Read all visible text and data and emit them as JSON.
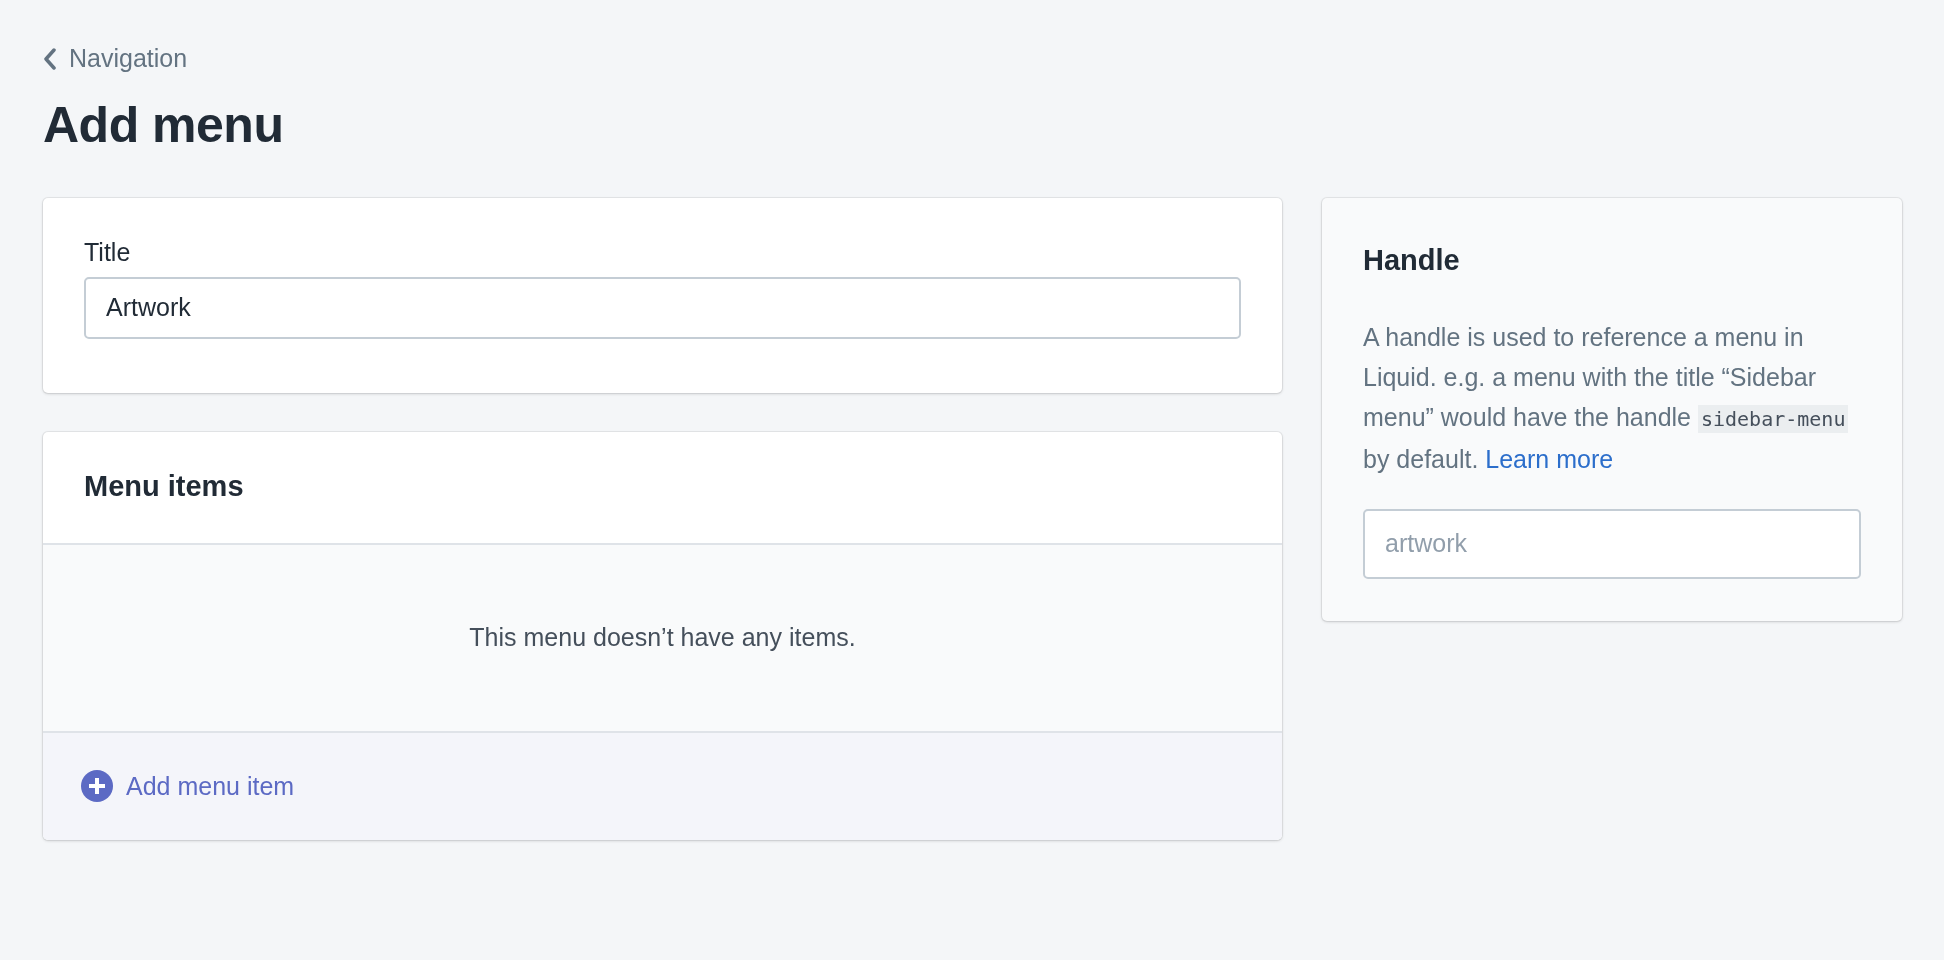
{
  "back_link": {
    "label": "Navigation"
  },
  "page_title": "Add menu",
  "title_card": {
    "label": "Title",
    "value": "Artwork"
  },
  "menu_items_card": {
    "title": "Menu items",
    "empty_message": "This menu doesn’t have any items.",
    "add_button": "Add menu item"
  },
  "handle_card": {
    "title": "Handle",
    "description": {
      "before": "A handle is used to reference a menu in Liquid. e.g. a menu with the title “Sidebar menu” would have the handle ",
      "code": "sidebar-menu",
      "after": " by default. ",
      "link": "Learn more"
    },
    "placeholder": "artwork"
  }
}
